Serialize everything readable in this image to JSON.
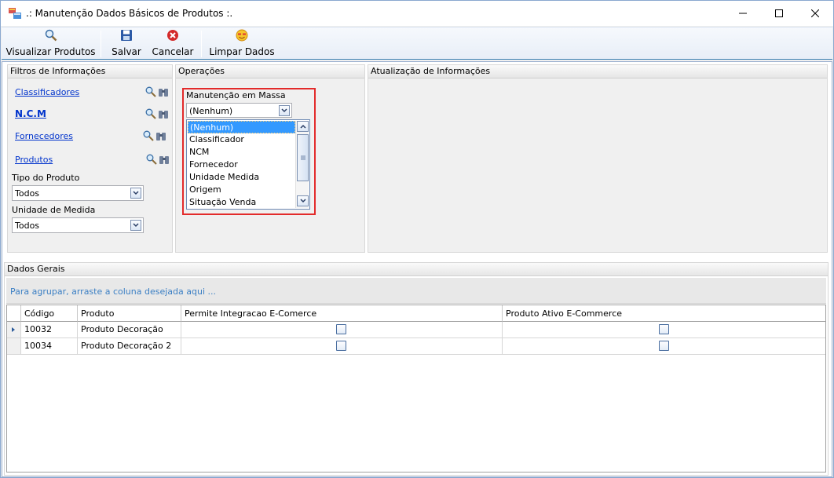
{
  "window": {
    "title": ".: Manutenção Dados Básicos de Produtos :."
  },
  "toolbar": {
    "view_label": "Visualizar Produtos",
    "save_label": "Salvar",
    "cancel_label": "Cancelar",
    "clear_label": "Limpar Dados"
  },
  "filters": {
    "header": "Filtros de Informações",
    "link_classificadores": "Classificadores",
    "link_ncm": "N.C.M",
    "link_fornecedores": "Fornecedores",
    "link_produtos": "Produtos",
    "tipo_label": "Tipo do Produto",
    "tipo_value": "Todos",
    "unidade_label": "Unidade de Medida",
    "unidade_value": "Todos"
  },
  "operations": {
    "header": "Operações",
    "mass_label": "Manutenção em Massa",
    "mass_value": "(Nenhum)",
    "options": [
      "(Nenhum)",
      "Classificador",
      "NCM",
      "Fornecedor",
      "Unidade Medida",
      "Origem",
      "Situação Venda"
    ],
    "selected_index": 0
  },
  "updates": {
    "header": "Atualização de Informações"
  },
  "general": {
    "header": "Dados Gerais",
    "group_hint": "Para agrupar, arraste a coluna desejada aqui ...",
    "columns": [
      "Código",
      "Produto",
      "Permite Integracao E-Comerce",
      "Produto Ativo E-Commerce"
    ],
    "rows": [
      {
        "codigo": "10032",
        "produto": "Produto Decoração",
        "integracao": false,
        "ativo": false
      },
      {
        "codigo": "10034",
        "produto": "Produto Decoração 2",
        "integracao": false,
        "ativo": false
      }
    ]
  },
  "colors": {
    "accent": "#3399ff",
    "highlight": "#e32b2b",
    "link": "#0033cc"
  }
}
